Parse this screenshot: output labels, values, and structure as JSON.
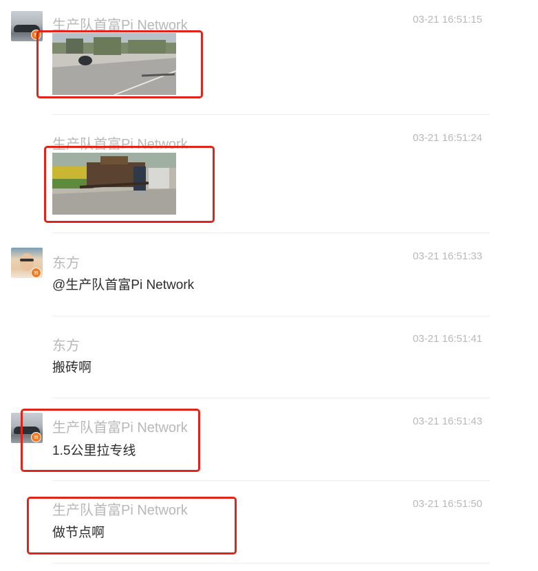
{
  "messages": [
    {
      "sender": "生产队首富Pi Network",
      "time": "03-21 16:51:15",
      "avatar": "car-avatar",
      "content_type": "image",
      "highlighted": true
    },
    {
      "sender": "生产队首富Pi Network",
      "time": "03-21 16:51:24",
      "content_type": "image",
      "highlighted": true
    },
    {
      "sender": "东方",
      "time": "03-21 16:51:33",
      "avatar": "person-avatar",
      "content_type": "text",
      "text": "@生产队首富Pi Network"
    },
    {
      "sender": "东方",
      "time": "03-21 16:51:41",
      "content_type": "text",
      "text": "搬砖啊"
    },
    {
      "sender": "生产队首富Pi Network",
      "time": "03-21 16:51:43",
      "avatar": "car-avatar",
      "content_type": "text",
      "text": "1.5公里拉专线",
      "highlighted": true
    },
    {
      "sender": "生产队首富Pi Network",
      "time": "03-21 16:51:50",
      "content_type": "text",
      "text": "做节点啊",
      "highlighted": true
    }
  ],
  "colors": {
    "highlight": "#e2231a",
    "meta_text": "#b8b8b8",
    "body_text": "#2d2d2d",
    "separator": "#ececec",
    "badge": "#f07b22"
  }
}
